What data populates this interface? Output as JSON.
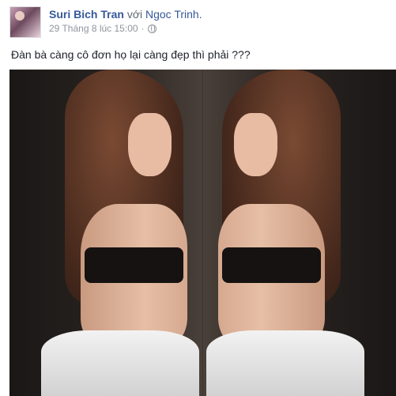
{
  "post": {
    "author": "Suri Bich Tran",
    "with_word": "với",
    "tagged_user": "Ngoc Trinh.",
    "timestamp": "29 Tháng 8 lúc 15:00",
    "separator": "·",
    "privacy_icon": "globe-icon",
    "caption": "Đàn bà càng cô đơn họ lại càng đẹp thì phải ???"
  },
  "colors": {
    "link": "#365899",
    "meta": "#90949c",
    "text": "#1d2129"
  }
}
